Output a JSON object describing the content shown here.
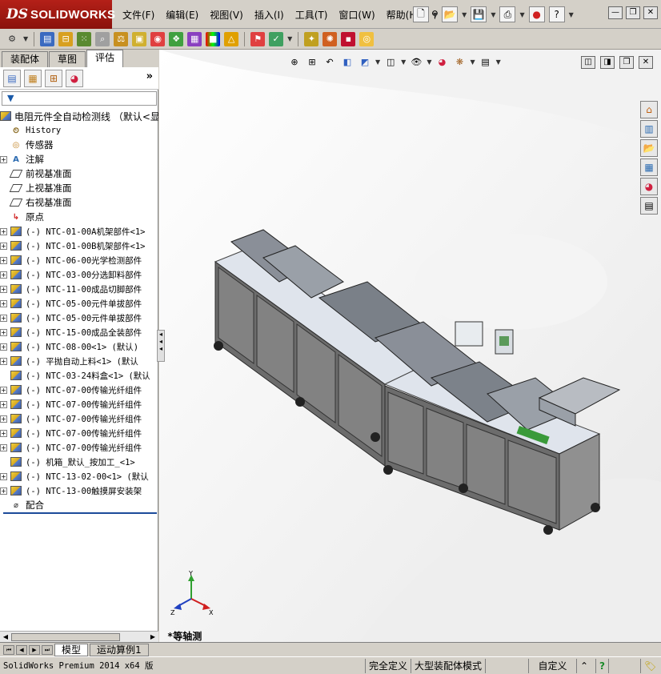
{
  "app": {
    "logo_ds": "DS",
    "logo_text": "SOLIDWORKS"
  },
  "menu": [
    {
      "label": "文件(F)"
    },
    {
      "label": "编辑(E)"
    },
    {
      "label": "视图(V)"
    },
    {
      "label": "插入(I)"
    },
    {
      "label": "工具(T)"
    },
    {
      "label": "窗口(W)"
    },
    {
      "label": "帮助(H)"
    }
  ],
  "left_tabs": [
    {
      "label": "装配体"
    },
    {
      "label": "草图"
    },
    {
      "label": "评估"
    }
  ],
  "tree": {
    "root_label": "电阻元件全自动检测线 （默认<显",
    "items": [
      {
        "label": "History",
        "icon": "history-icon",
        "expand": false,
        "mono": true
      },
      {
        "label": "传感器",
        "icon": "sensor-icon",
        "expand": false,
        "mono": false
      },
      {
        "label": "注解",
        "icon": "annotation-icon",
        "expand": true,
        "mono": false
      },
      {
        "label": "前视基准面",
        "icon": "plane-icon",
        "expand": false,
        "mono": false
      },
      {
        "label": "上视基准面",
        "icon": "plane-icon",
        "expand": false,
        "mono": false
      },
      {
        "label": "右视基准面",
        "icon": "plane-icon",
        "expand": false,
        "mono": false
      },
      {
        "label": "原点",
        "icon": "origin-icon",
        "expand": false,
        "mono": false
      },
      {
        "label": "(-) NTC-01-00A机架部件<1>",
        "icon": "assembly-icon",
        "expand": true,
        "mono": true
      },
      {
        "label": "(-) NTC-01-00B机架部件<1>",
        "icon": "assembly-icon",
        "expand": true,
        "mono": true
      },
      {
        "label": "(-) NTC-06-00光学检测部件",
        "icon": "assembly-icon",
        "expand": true,
        "mono": true
      },
      {
        "label": "(-) NTC-03-00分选卸料部件",
        "icon": "assembly-icon",
        "expand": true,
        "mono": true
      },
      {
        "label": "(-) NTC-11-00成品切脚部件",
        "icon": "assembly-icon",
        "expand": true,
        "mono": true
      },
      {
        "label": "(-) NTC-05-00元件单拔部件",
        "icon": "assembly-icon",
        "expand": true,
        "mono": true
      },
      {
        "label": "(-) NTC-05-00元件单拔部件",
        "icon": "assembly-icon",
        "expand": true,
        "mono": true
      },
      {
        "label": "(-) NTC-15-00成品全装部件",
        "icon": "assembly-icon",
        "expand": true,
        "mono": true
      },
      {
        "label": "(-) NTC-08-00<1> (默认)",
        "icon": "assembly-icon",
        "expand": true,
        "mono": true
      },
      {
        "label": "(-) 平抛自动上料<1> (默认",
        "icon": "assembly-icon",
        "expand": true,
        "mono": true
      },
      {
        "label": "(-) NTC-03-24料盒<1> (默认",
        "icon": "assembly-icon",
        "expand": false,
        "mono": true
      },
      {
        "label": "(-) NTC-07-00传输光纤组件",
        "icon": "assembly-icon",
        "expand": true,
        "mono": true
      },
      {
        "label": "(-) NTC-07-00传输光纤组件",
        "icon": "assembly-icon",
        "expand": true,
        "mono": true
      },
      {
        "label": "(-) NTC-07-00传输光纤组件",
        "icon": "assembly-icon",
        "expand": true,
        "mono": true
      },
      {
        "label": "(-) NTC-07-00传输光纤组件",
        "icon": "assembly-icon",
        "expand": true,
        "mono": true
      },
      {
        "label": "(-) NTC-07-00传输光纤组件",
        "icon": "assembly-icon",
        "expand": true,
        "mono": true
      },
      {
        "label": "(-) 机箱_默认_按加工_<1>",
        "icon": "assembly-icon",
        "expand": false,
        "mono": true
      },
      {
        "label": "(-) NTC-13-02-00<1> (默认",
        "icon": "assembly-icon",
        "expand": true,
        "mono": true
      },
      {
        "label": "(-) NTC-13-00触摸屏安装架",
        "icon": "assembly-icon",
        "expand": true,
        "mono": true
      },
      {
        "label": "配合",
        "icon": "mates-icon",
        "expand": false,
        "mono": false
      }
    ]
  },
  "graphics": {
    "view_name": "*等轴测",
    "triad_x": "X",
    "triad_y": "Y",
    "triad_z": "Z"
  },
  "bottom_tabs": [
    {
      "label": "模型"
    },
    {
      "label": "运动算例1"
    }
  ],
  "status": {
    "product": "SolidWorks Premium 2014 x64 版",
    "definition": "完全定义",
    "mode": "大型装配体模式",
    "custom": "自定义",
    "custom_caret": "⌃"
  },
  "colors": {
    "brand_red": "#b42018",
    "tree_blue": "#1c4a9a"
  }
}
